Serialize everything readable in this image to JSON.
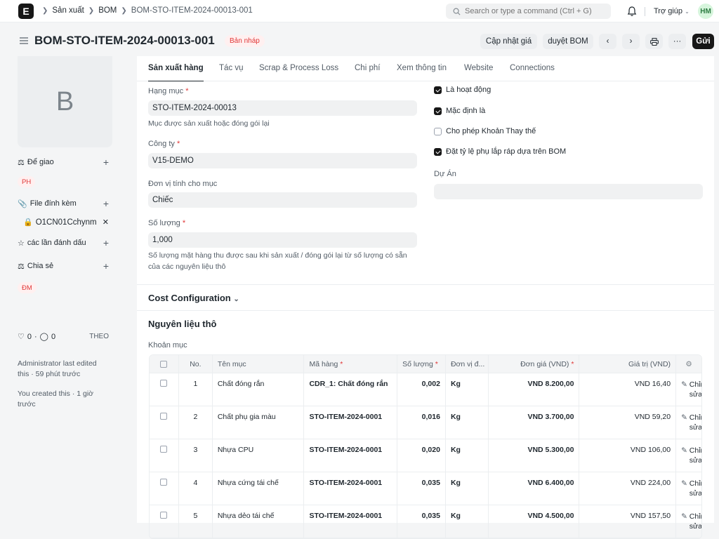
{
  "topbar": {
    "logo": "E",
    "breadcrumbs": [
      "Sản xuất",
      "BOM",
      "BOM-STO-ITEM-2024-00013-001"
    ],
    "search_placeholder": "Search or type a command (Ctrl + G)",
    "help": "Trợ giúp",
    "avatar": "HM"
  },
  "header": {
    "title": "BOM-STO-ITEM-2024-00013-001",
    "status": "Bản nháp",
    "btn_update_price": "Cập nhật giá",
    "btn_browse_bom": "duyệt BOM",
    "btn_submit": "Gửi",
    "btn_more": "···"
  },
  "sidebar": {
    "image_letter": "B",
    "assign_label": "Để giao",
    "assign_pill": "PH",
    "attachments_label": "File đính kèm",
    "attachment_file": "O1CN01Cchynm",
    "likes_label": "các lần đánh dấu",
    "share_label": "Chia sẻ",
    "share_pill": "ĐM",
    "likes_count": "0",
    "comments_count": "0",
    "follow": "THEO",
    "last_edited": "Administrator last edited this · 59 phút trước",
    "created": "You created this · 1 giờ trước"
  },
  "tabs": [
    "Sản xuất hàng",
    "Tác vụ",
    "Scrap & Process Loss",
    "Chi phí",
    "Xem thông tin",
    "Website",
    "Connections"
  ],
  "form": {
    "item_label": "Hạng mục",
    "item_value": "STO-ITEM-2024-00013",
    "item_desc": "Mục được sản xuất hoặc đóng gói lại",
    "company_label": "Công ty",
    "company_value": "V15-DEMO",
    "uom_label": "Đơn vị tính cho mục",
    "uom_value": "Chiếc",
    "qty_label": "Số lượng",
    "qty_value": "1,000",
    "qty_desc_1": "Số lượng mặt hàng thu được sau khi sản xuất / đóng gói lại từ số lượng có sẵn",
    "qty_desc_2": "của các nguyên liệu thô",
    "chk_active": "Là hoạt động",
    "chk_default": "Mặc định là",
    "chk_alt": "Cho phép Khoản Thay thế",
    "chk_rate": "Đặt tỷ lệ phụ lắp ráp dựa trên BOM",
    "project_label": "Dự Án",
    "project_value": ""
  },
  "sections": {
    "cost_config": "Cost Configuration",
    "raw_materials": "Nguyên liệu thô",
    "items_label": "Khoản mục"
  },
  "table": {
    "headers": [
      "No.",
      "Tên mục",
      "Mã hàng",
      "Số lượng",
      "Đơn vị đ...",
      "Đơn giá (VND)",
      "Giá trị (VND)"
    ],
    "edit_label": "Chỉnh sửa",
    "rows": [
      {
        "no": "1",
        "name": "Chất đóng rắn",
        "code": "CDR_1: Chất đóng rắn",
        "qty": "0,002",
        "uom": "Kg",
        "rate": "VND 8.200,00",
        "amount": "VND 16,40"
      },
      {
        "no": "2",
        "name": "Chất phụ gia màu",
        "code": "STO-ITEM-2024-0001",
        "qty": "0,016",
        "uom": "Kg",
        "rate": "VND 3.700,00",
        "amount": "VND 59,20"
      },
      {
        "no": "3",
        "name": "Nhựa CPU",
        "code": "STO-ITEM-2024-0001",
        "qty": "0,020",
        "uom": "Kg",
        "rate": "VND 5.300,00",
        "amount": "VND 106,00"
      },
      {
        "no": "4",
        "name": "Nhựa cứng tái chế",
        "code": "STO-ITEM-2024-0001",
        "qty": "0,035",
        "uom": "Kg",
        "rate": "VND 6.400,00",
        "amount": "VND 224,00"
      },
      {
        "no": "5",
        "name": "Nhựa dẻo tái chế",
        "code": "STO-ITEM-2024-0001",
        "qty": "0,035",
        "uom": "Kg",
        "rate": "VND 4.500,00",
        "amount": "VND 157,50"
      }
    ]
  },
  "colors": {
    "accent": "#171717",
    "danger": "#e03636",
    "field_bg": "#f0f1f2"
  }
}
